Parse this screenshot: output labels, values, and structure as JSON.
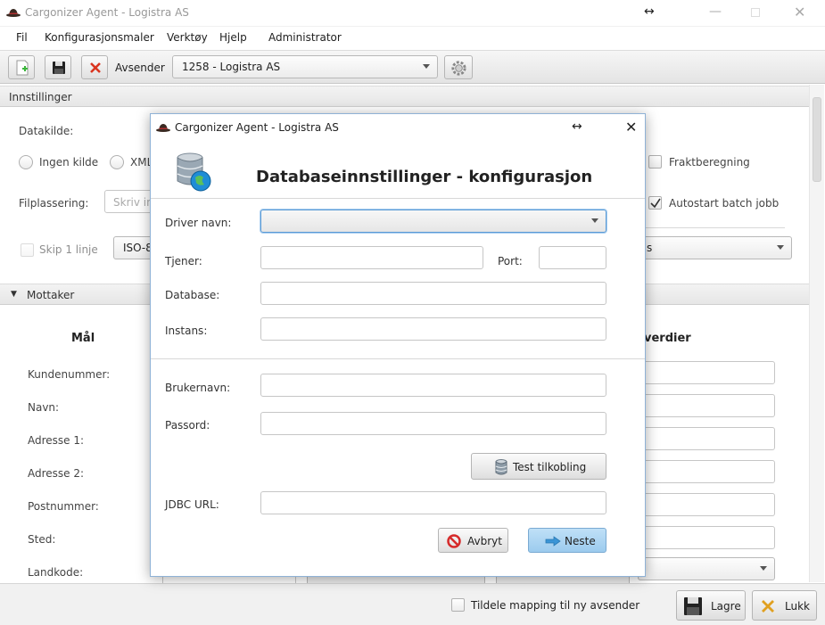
{
  "window": {
    "title": "Cargonizer Agent - Logistra AS",
    "resize_glyph": "↔"
  },
  "menu": [
    "Fil",
    "Konfigurasjonsmaler",
    "Verktøy",
    "Hjelp",
    "Administrator"
  ],
  "toolbar": {
    "sender_label": "Avsender",
    "sender_value": "1258 - Logistra AS"
  },
  "settings": {
    "header": "Innstillinger",
    "datakilde_label": "Datakilde:",
    "radio_none": "Ingen kilde",
    "radio_xml": "XML",
    "filplassering_label": "Filplassering:",
    "filplassering_placeholder": "Skriv in",
    "skip_label": "Skip 1 linje",
    "encoding_value": "ISO-8",
    "right_combo_value": "s",
    "fraktberegning_label": "Fraktberegning",
    "autostart_label": "Autostart batch jobb"
  },
  "mottaker": {
    "header": "Mottaker",
    "col_target": "Mål",
    "col_values": "verdier",
    "fields": [
      "Kundenummer:",
      "Navn:",
      "Adresse 1:",
      "Adresse 2:",
      "Postnummer:",
      "Sted:",
      "Landkode:"
    ]
  },
  "bottom": {
    "assign_label": "Tildele mapping til ny avsender",
    "save_label": "Lagre",
    "close_label": "Lukk"
  },
  "dialog": {
    "title": "Cargonizer Agent - Logistra AS",
    "heading": "Databaseinnstillinger - konfigurasjon",
    "driver_label": "Driver navn:",
    "server_label": "Tjener:",
    "port_label": "Port:",
    "database_label": "Database:",
    "instance_label": "Instans:",
    "username_label": "Brukernavn:",
    "password_label": "Passord:",
    "test_button": "Test tilkobling",
    "jdbc_label": "JDBC URL:",
    "cancel_button": "Avbryt",
    "next_button": "Neste"
  },
  "colors": {
    "accent": "#9ccbee",
    "cancel_red": "#d62b2b",
    "close_x": "#e0a020"
  }
}
